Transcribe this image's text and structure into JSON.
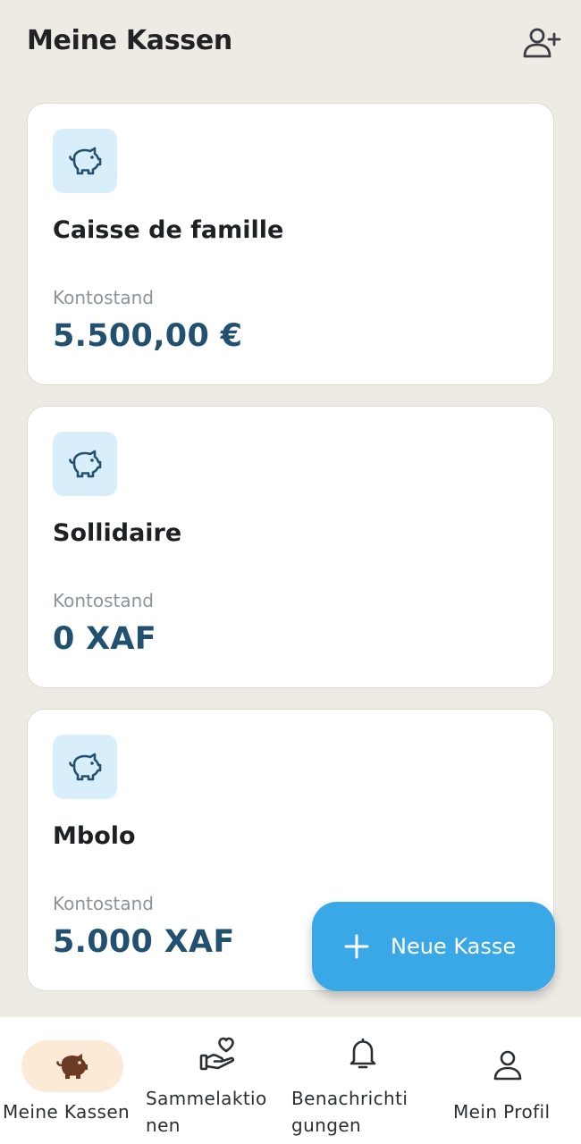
{
  "header": {
    "title": "Meine Kassen",
    "add_member_icon": "person-add-icon"
  },
  "cards": [
    {
      "name": "Caisse de famille",
      "balance_label": "Kontostand",
      "balance": "5.500,00 €",
      "icon": "piggy-bank-icon"
    },
    {
      "name": "Sollidaire",
      "balance_label": "Kontostand",
      "balance": "0 XAF",
      "icon": "piggy-bank-icon"
    },
    {
      "name": "Mbolo",
      "balance_label": "Kontostand",
      "balance": "5.000 XAF",
      "icon": "piggy-bank-icon"
    }
  ],
  "fab": {
    "label": "Neue Kasse",
    "icon": "plus-icon"
  },
  "bottom_nav": {
    "items": [
      {
        "label": "Meine Kassen",
        "icon": "piggy-bank-icon",
        "active": true
      },
      {
        "label_line1": "Sammelaktio",
        "label_line2": "nen",
        "icon": "heart-hand-icon"
      },
      {
        "label_line1": "Benachrichti",
        "label_line2": "gungen",
        "icon": "bell-icon"
      },
      {
        "label": "Mein Profil",
        "icon": "person-icon"
      }
    ]
  },
  "colors": {
    "background": "#EEEBE4",
    "card_icon_bg": "#D8EEFB",
    "amount_text": "#225070",
    "fab_bg": "#3AA8E6",
    "active_nav_bg": "#FCEAD6",
    "active_nav_icon": "#6B3A22"
  }
}
